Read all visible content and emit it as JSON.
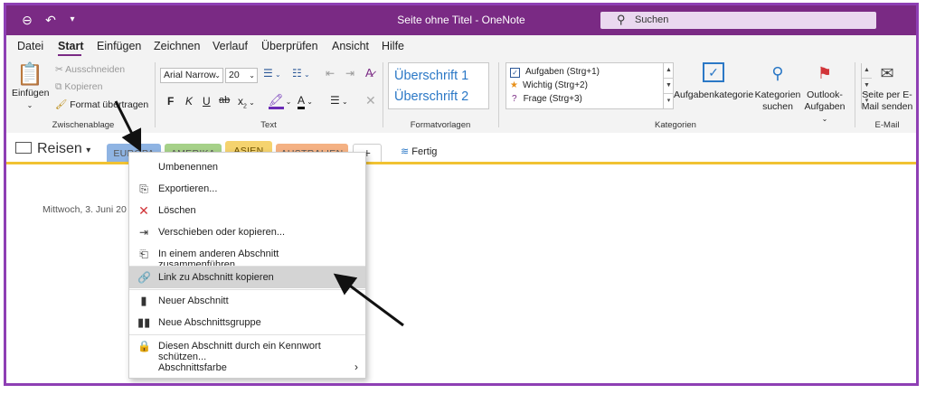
{
  "titlebar": {
    "title": "Seite ohne Titel - OneNote",
    "search_placeholder": "Suchen",
    "back_icon": "back-icon",
    "undo_icon": "undo-icon",
    "customize_icon": "customize-icon",
    "color": "#7a2a84"
  },
  "menu": {
    "items": [
      "Datei",
      "Start",
      "Einfügen",
      "Zeichnen",
      "Verlauf",
      "Überprüfen",
      "Ansicht",
      "Hilfe"
    ],
    "active": "Start"
  },
  "ribbon": {
    "clipboard": {
      "paste": "Einfügen",
      "cut": "Ausschneiden",
      "copy": "Kopieren",
      "format_painter": "Format übertragen",
      "label": "Zwischenablage"
    },
    "text": {
      "font": "Arial Narrow",
      "size": "20",
      "label": "Text",
      "bold": "F",
      "italic": "K",
      "underline": "U",
      "strike": "ab",
      "subscript": "x",
      "font_color_letter": "A"
    },
    "styles": {
      "heading1": "Überschrift 1",
      "heading2": "Überschrift 2",
      "label": "Formatvorlagen"
    },
    "tags": {
      "items": [
        "Aufgaben (Strg+1)",
        "Wichtig (Strg+2)",
        "Frage (Strg+3)"
      ],
      "category_button": "Aufgabenkategorie",
      "search_line1": "Kategorien",
      "search_line2": "suchen",
      "outlook_line1": "Outlook-",
      "outlook_line2": "Aufgaben",
      "label": "Kategorien"
    },
    "email": {
      "line1": "Seite per E-",
      "line2": "Mail senden",
      "label": "E-Mail"
    }
  },
  "notebook": {
    "name": "Reisen",
    "sections": [
      {
        "label": "EUROPA",
        "color": "#8fb4e3"
      },
      {
        "label": "AMERIKA",
        "color": "#a6d189"
      },
      {
        "label": "ASIEN",
        "color": "#f5d36e"
      },
      {
        "label": "AUSTRALIEN",
        "color": "#f4b183"
      }
    ],
    "add_label": "+",
    "done_label": "Fertig"
  },
  "page": {
    "date": "Mittwoch, 3. Juni 20"
  },
  "context_menu": {
    "items": [
      {
        "label": "Umbenennen",
        "icon": "none"
      },
      {
        "label": "Exportieren...",
        "icon": "export-icon"
      },
      {
        "label": "Löschen",
        "icon": "delete-icon"
      },
      {
        "label": "Verschieben oder kopieren...",
        "icon": "move-icon"
      },
      {
        "label": "In einem anderen Abschnitt zusammenführen...",
        "icon": "merge-icon"
      },
      {
        "label": "Link zu Abschnitt kopieren",
        "icon": "link-icon"
      },
      {
        "label": "Neuer Abschnitt",
        "icon": "new-section-icon"
      },
      {
        "label": "Neue Abschnittsgruppe",
        "icon": "new-section-group-icon"
      },
      {
        "label": "Diesen Abschnitt durch ein Kennwort schützen...",
        "icon": "lock-icon"
      },
      {
        "label": "Abschnittsfarbe",
        "icon": "none"
      }
    ],
    "highlighted": "Link zu Abschnitt kopieren"
  }
}
